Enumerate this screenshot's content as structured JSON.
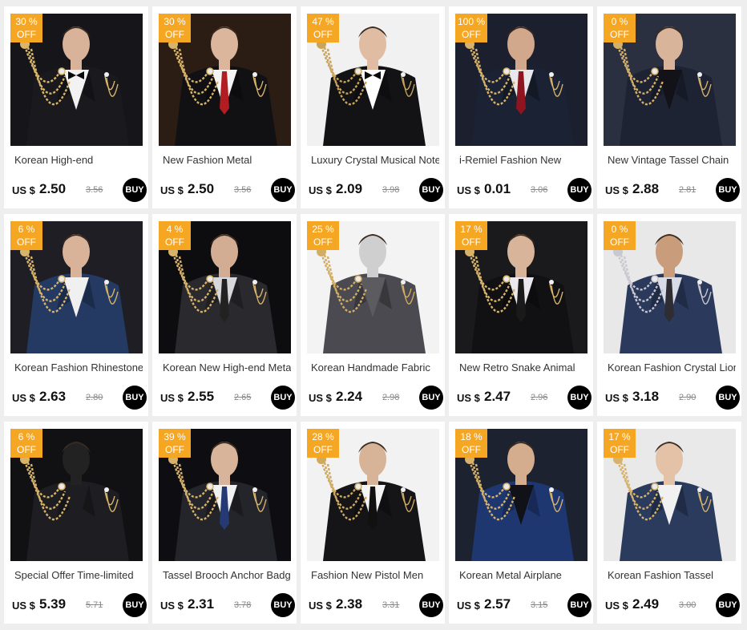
{
  "currency": "US $",
  "buy_label": "BUY",
  "badge_suffix": "OFF",
  "colors": {
    "badge": "#f5a623",
    "buy_button": "#000000",
    "card": "#ffffff",
    "background": "#eeeeee"
  },
  "products": [
    {
      "discount": "30 %",
      "title": "Korean High-end",
      "price": "2.50",
      "original": "3.56",
      "scene": "black-suit-bowtie"
    },
    {
      "discount": "30 %",
      "title": "New Fashion Metal",
      "price": "2.50",
      "original": "3.56",
      "scene": "red-tie-tassel"
    },
    {
      "discount": "47 %",
      "title": "Luxury Crystal Musical Note",
      "price": "2.09",
      "original": "3.98",
      "scene": "musical-note-chain"
    },
    {
      "discount": "100 %",
      "title": "i-Remiel Fashion New",
      "price": "0.01",
      "original": "3.06",
      "scene": "blue-gem-chain"
    },
    {
      "discount": "0 %",
      "title": "New Vintage Tassel Chain",
      "price": "2.88",
      "original": "2.81",
      "scene": "heart-chain-navy-coat"
    },
    {
      "discount": "6 %",
      "title": "Korean Fashion Rhinestone",
      "price": "2.63",
      "original": "2.80",
      "scene": "blue-suit-star"
    },
    {
      "discount": "4 %",
      "title": "Korean New High-end Metal",
      "price": "2.55",
      "original": "2.65",
      "scene": "cross-vest"
    },
    {
      "discount": "25 %",
      "title": "Korean Handmade Fabric",
      "price": "2.24",
      "original": "2.98",
      "scene": "red-rose-pin"
    },
    {
      "discount": "17 %",
      "title": "New Retro Snake Animal",
      "price": "2.47",
      "original": "2.96",
      "scene": "anchor-snake-chain"
    },
    {
      "discount": "0 %",
      "title": "Korean Fashion Crystal Lion",
      "price": "3.18",
      "original": "2.90",
      "scene": "lion-chain-model"
    },
    {
      "discount": "6 %",
      "title": "Special Offer Time-limited",
      "price": "5.39",
      "original": "5.71",
      "scene": "crystal-bow-tassel"
    },
    {
      "discount": "39 %",
      "title": "Tassel Brooch Anchor Badge",
      "price": "2.31",
      "original": "3.78",
      "scene": "anchor-badge-suit"
    },
    {
      "discount": "28 %",
      "title": "Fashion New Pistol Men",
      "price": "2.38",
      "original": "3.31",
      "scene": "pistol-chain-sunglasses"
    },
    {
      "discount": "18 %",
      "title": "Korean Metal Airplane",
      "price": "2.57",
      "original": "3.15",
      "scene": "airplane-blue-suit"
    },
    {
      "discount": "17 %",
      "title": "Korean Fashion Tassel",
      "price": "2.49",
      "original": "3.00",
      "scene": "crown-tassel-model"
    }
  ]
}
